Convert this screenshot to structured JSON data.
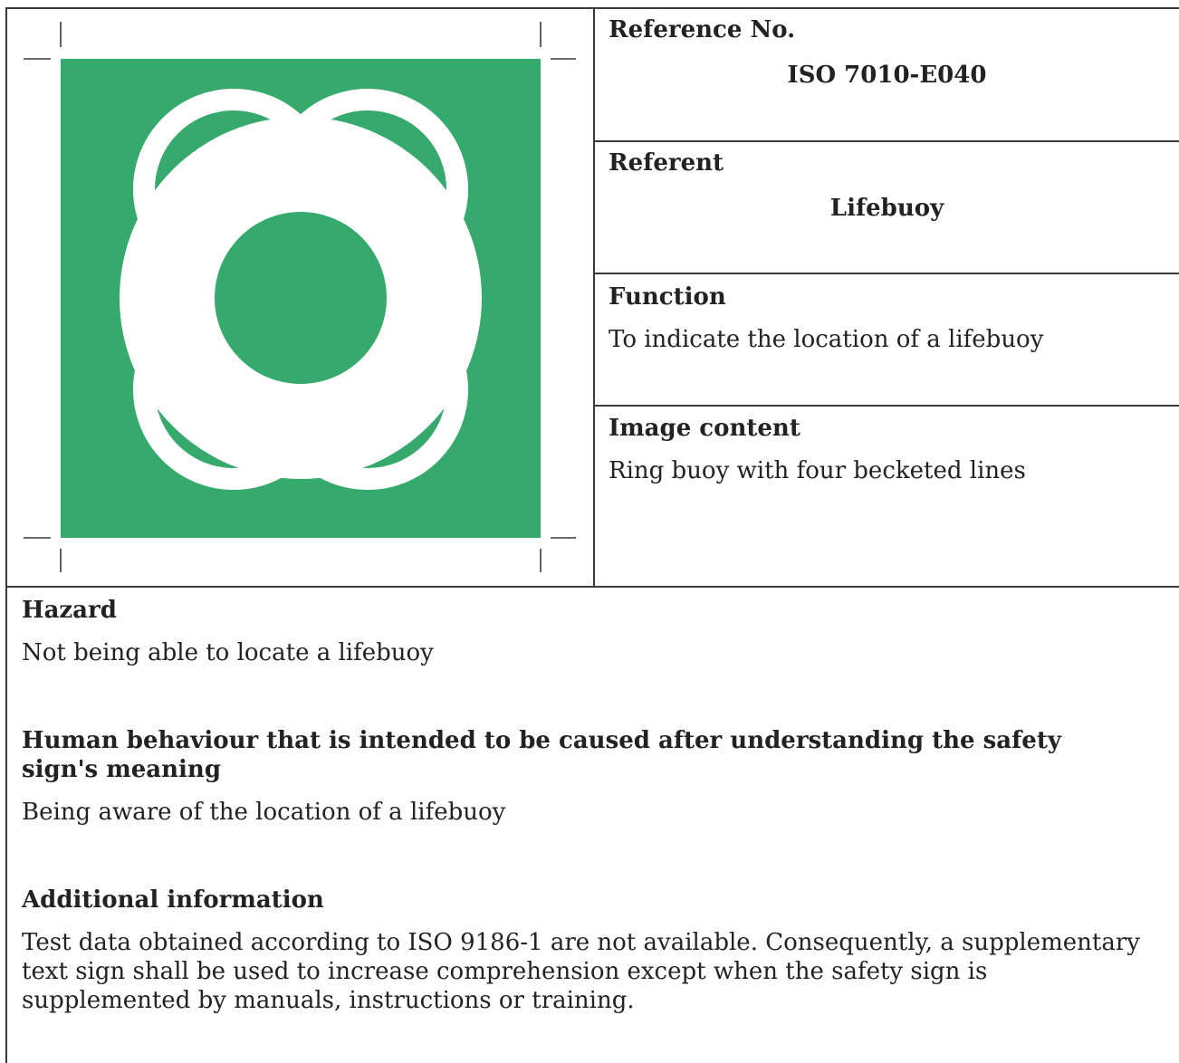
{
  "reference": {
    "label": "Reference No.",
    "value": "ISO 7010-E040"
  },
  "referent": {
    "label": "Referent",
    "value": "Lifebuoy"
  },
  "function": {
    "label": "Function",
    "value": "To indicate the location of a lifebuoy"
  },
  "image_content": {
    "label": "Image content",
    "value": "Ring buoy with four becketed lines"
  },
  "hazard": {
    "label": "Hazard",
    "value": "Not being able to locate a lifebuoy"
  },
  "behaviour": {
    "label": "Human behaviour that is intended to be caused after understanding the safety sign's meaning",
    "value": "Being aware of the location of a lifebuoy"
  },
  "additional": {
    "label": "Additional information",
    "value": "Test data obtained according to ISO 9186-1 are not available. Consequently, a supplementary text sign shall be used to increase comprehension except when the safety sign is supplemented by manuals, instructions or training."
  },
  "sign": {
    "icon": "lifebuoy-icon",
    "background_color": "#36A96D",
    "symbol_color": "#FFFFFF"
  }
}
